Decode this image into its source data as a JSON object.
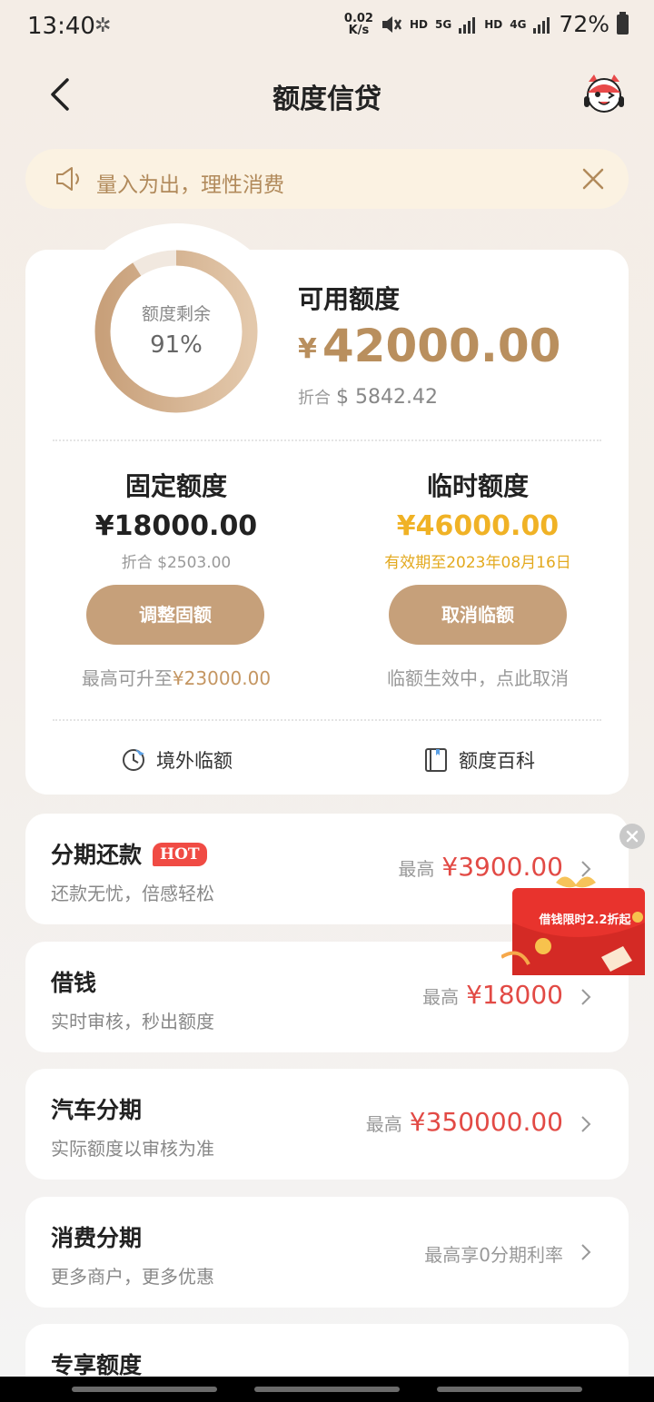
{
  "status_bar": {
    "time": "13:40",
    "net_speed_value": "0.02",
    "net_speed_unit": "K/s",
    "hd1": "HD",
    "sig1": "5G",
    "hd2": "HD",
    "sig2": "4G",
    "battery": "72%"
  },
  "header": {
    "title": "额度信贷"
  },
  "notice": {
    "text": "量入为出，理性消费"
  },
  "credit": {
    "ring_label": "额度剩余",
    "ring_value": "91%",
    "ring_fraction": 0.91,
    "available_label": "可用额度",
    "currency": "¥",
    "available_amount": "42000.00",
    "converted_label": "折合",
    "converted_amount": "$ 5842.42"
  },
  "fixed": {
    "title": "固定额度",
    "amount": "¥18000.00",
    "converted": "折合 $2503.00",
    "button": "调整固额",
    "hint_prefix": "最高可升至",
    "hint_amount": "¥23000.00"
  },
  "temporary": {
    "title": "临时额度",
    "amount": "¥46000.00",
    "validity": "有效期至2023年08月16日",
    "button": "取消临额",
    "hint": "临额生效中，点此取消"
  },
  "quick_links": [
    {
      "label": "境外临额",
      "icon": "plane-clock-icon"
    },
    {
      "label": "额度百科",
      "icon": "book-icon"
    }
  ],
  "products": [
    {
      "title": "分期还款",
      "badge": "HOT",
      "subtitle": "还款无忧，倍感轻松",
      "prefix": "最高",
      "amount": "¥3900.00"
    },
    {
      "title": "借钱",
      "subtitle": "实时审核，秒出额度",
      "prefix": "最高",
      "amount": "¥18000"
    },
    {
      "title": "汽车分期",
      "subtitle": "实际额度以审核为准",
      "prefix": "最高",
      "amount": "¥350000.00"
    },
    {
      "title": "消费分期",
      "subtitle": "更多商户，更多优惠",
      "prefix": "最高享0分期利率",
      "amount": ""
    },
    {
      "title": "专享额度",
      "subtitle": "",
      "prefix": "",
      "amount": ""
    }
  ],
  "promo": {
    "text": "借钱限时2.2折起"
  },
  "colors": {
    "accent_gold": "#c6a07a",
    "amount_gold": "#b98f5e",
    "temp_gold": "#f0b225",
    "red": "#e24a45"
  }
}
